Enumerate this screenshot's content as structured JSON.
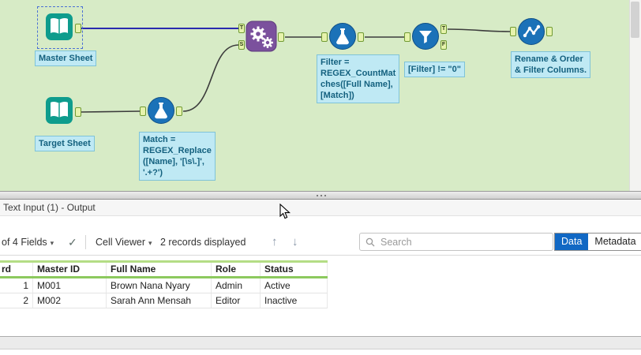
{
  "colors": {
    "canvas_bg": "#d7ebc6",
    "annotation_bg": "#bfe9f4",
    "annotation_text": "#14617f",
    "input_tool": "#0e9c8d",
    "process_tool": "#1b72b8",
    "append_tool": "#7b519d",
    "selected_wire": "#2a2aae",
    "data_tab_active": "#1168c4",
    "grid_header_underline": "#8cc95e"
  },
  "canvas": {
    "tools": {
      "master_sheet": {
        "label": "Master Sheet"
      },
      "target_sheet": {
        "label": "Target Sheet"
      },
      "formula_match": {
        "annotation": "Match =\nREGEX_Replace\n([Name], '[\\s\\.]',\n'.+?')"
      },
      "append_fields": {
        "input_top": "T",
        "input_bottom": "S"
      },
      "formula_filter": {
        "annotation": "Filter =\nREGEX_CountMat\nches([Full Name],\n[Match])"
      },
      "filter": {
        "annotation": "[Filter] != \"0\"",
        "output_true": "T",
        "output_false": "F"
      },
      "select": {
        "annotation": "Rename & Order\n& Filter Columns."
      }
    }
  },
  "results_panel": {
    "title": "Text Input (1) - Output",
    "toolbar": {
      "fields_dropdown": "of 4 Fields",
      "cell_viewer_dropdown": "Cell Viewer",
      "records_label": "2 records displayed",
      "search_placeholder": "Search",
      "data_tab": "Data",
      "metadata_tab": "Metadata"
    },
    "grid": {
      "headers": [
        "rd",
        "Master ID",
        "Full Name",
        "Role",
        "Status"
      ],
      "rows": [
        [
          "1",
          "M001",
          "Brown Nana Nyary",
          "Admin",
          "Active"
        ],
        [
          "2",
          "M002",
          "Sarah Ann Mensah",
          "Editor",
          "Inactive"
        ]
      ]
    }
  }
}
